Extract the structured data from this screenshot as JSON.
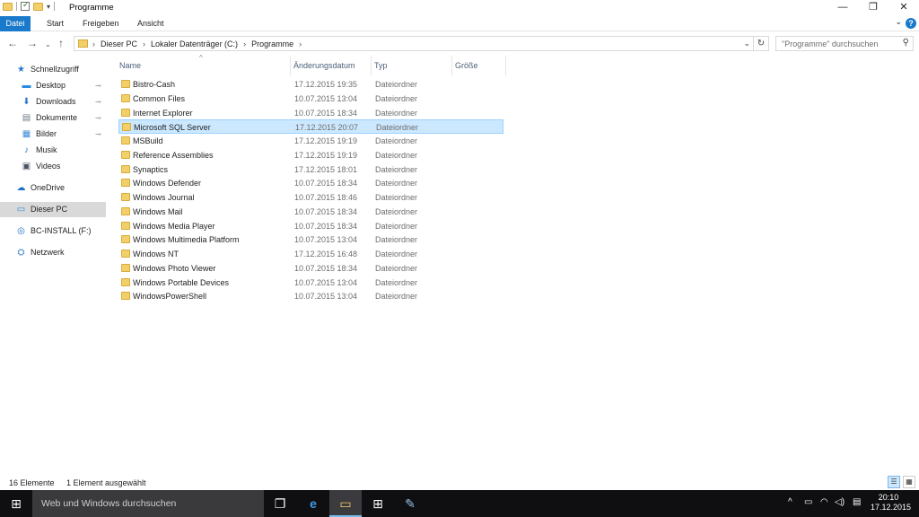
{
  "window": {
    "title": "Programme",
    "controls": {
      "minimize": "—",
      "restore": "❐",
      "close": "✕"
    }
  },
  "ribbon": {
    "tabs": [
      {
        "label": "Datei"
      },
      {
        "label": "Start"
      },
      {
        "label": "Freigeben"
      },
      {
        "label": "Ansicht"
      }
    ],
    "expand": "⌄",
    "help": "?"
  },
  "nav": {
    "back": "←",
    "forward": "→",
    "history": "⌄",
    "up": "↑",
    "breadcrumbs": [
      "Dieser PC",
      "Lokaler Datenträger (C:)",
      "Programme"
    ],
    "crumb_sep": "›",
    "address_dropdown": "⌄",
    "refresh": "↻",
    "search_placeholder": "\"Programme\" durchsuchen",
    "search_icon": "⚲"
  },
  "sidebar": {
    "items": [
      {
        "label": "Schnellzugriff",
        "icon": "star-icon",
        "glyph": "★",
        "color": "#2b78c9",
        "pinned": false
      },
      {
        "label": "Desktop",
        "icon": "desktop-icon",
        "glyph": "▬",
        "color": "#2b8be0",
        "pinned": true
      },
      {
        "label": "Downloads",
        "icon": "download-icon",
        "glyph": "⬇",
        "color": "#2b78c9",
        "pinned": true
      },
      {
        "label": "Dokumente",
        "icon": "documents-icon",
        "glyph": "▤",
        "color": "#6f7b88",
        "pinned": true
      },
      {
        "label": "Bilder",
        "icon": "pictures-icon",
        "glyph": "▦",
        "color": "#3c8ad6",
        "pinned": true
      },
      {
        "label": "Musik",
        "icon": "music-icon",
        "glyph": "♪",
        "color": "#2b78c9",
        "pinned": false
      },
      {
        "label": "Videos",
        "icon": "videos-icon",
        "glyph": "▣",
        "color": "#4a5563",
        "pinned": false
      },
      {
        "label": "OneDrive",
        "icon": "cloud-icon",
        "glyph": "☁",
        "color": "#1f6fc6",
        "pinned": false
      },
      {
        "label": "Dieser PC",
        "icon": "computer-icon",
        "glyph": "▭",
        "color": "#2b8be0",
        "pinned": false,
        "selected": true
      },
      {
        "label": "BC-INSTALL (F:)",
        "icon": "dvd-drive-icon",
        "glyph": "◎",
        "color": "#1f6fc6",
        "pinned": false
      },
      {
        "label": "Netzwerk",
        "icon": "network-icon",
        "glyph": "⛭",
        "color": "#2b78c9",
        "pinned": false
      }
    ],
    "pin_glyph": "📌"
  },
  "columns": {
    "name": "Name",
    "date": "Änderungsdatum",
    "type": "Typ",
    "size": "Größe",
    "sort_caret": "^"
  },
  "files": [
    {
      "name": "Bistro-Cash",
      "date": "17.12.2015 19:35",
      "type": "Dateiordner"
    },
    {
      "name": "Common Files",
      "date": "10.07.2015 13:04",
      "type": "Dateiordner"
    },
    {
      "name": "Internet Explorer",
      "date": "10.07.2015 18:34",
      "type": "Dateiordner"
    },
    {
      "name": "Microsoft SQL Server",
      "date": "17.12.2015 20:07",
      "type": "Dateiordner",
      "selected": true
    },
    {
      "name": "MSBuild",
      "date": "17.12.2015 19:19",
      "type": "Dateiordner"
    },
    {
      "name": "Reference Assemblies",
      "date": "17.12.2015 19:19",
      "type": "Dateiordner"
    },
    {
      "name": "Synaptics",
      "date": "17.12.2015 18:01",
      "type": "Dateiordner"
    },
    {
      "name": "Windows Defender",
      "date": "10.07.2015 18:34",
      "type": "Dateiordner"
    },
    {
      "name": "Windows Journal",
      "date": "10.07.2015 18:46",
      "type": "Dateiordner"
    },
    {
      "name": "Windows Mail",
      "date": "10.07.2015 18:34",
      "type": "Dateiordner"
    },
    {
      "name": "Windows Media Player",
      "date": "10.07.2015 18:34",
      "type": "Dateiordner"
    },
    {
      "name": "Windows Multimedia Platform",
      "date": "10.07.2015 13:04",
      "type": "Dateiordner"
    },
    {
      "name": "Windows NT",
      "date": "17.12.2015 16:48",
      "type": "Dateiordner"
    },
    {
      "name": "Windows Photo Viewer",
      "date": "10.07.2015 18:34",
      "type": "Dateiordner"
    },
    {
      "name": "Windows Portable Devices",
      "date": "10.07.2015 13:04",
      "type": "Dateiordner"
    },
    {
      "name": "WindowsPowerShell",
      "date": "10.07.2015 13:04",
      "type": "Dateiordner"
    }
  ],
  "status": {
    "count": "16 Elemente",
    "selection": "1 Element ausgewählt",
    "details_view": "☰",
    "tiles_view": "▦"
  },
  "taskbar": {
    "start": "⊞",
    "search_text": "Web und Windows durchsuchen",
    "apps": [
      {
        "name": "task-view-icon",
        "glyph": "❐"
      },
      {
        "name": "edge-icon",
        "glyph": "e"
      },
      {
        "name": "file-explorer-icon",
        "glyph": "▭",
        "active": true
      },
      {
        "name": "store-icon",
        "glyph": "⊞"
      },
      {
        "name": "paint-icon",
        "glyph": "✎"
      }
    ],
    "tray": {
      "chevron": "^",
      "battery": "▭",
      "network": "◠",
      "volume": "◁)",
      "notifications": "▤"
    },
    "time": "20:10",
    "date": "17.12.2015"
  },
  "accent_color": "#1979ca"
}
